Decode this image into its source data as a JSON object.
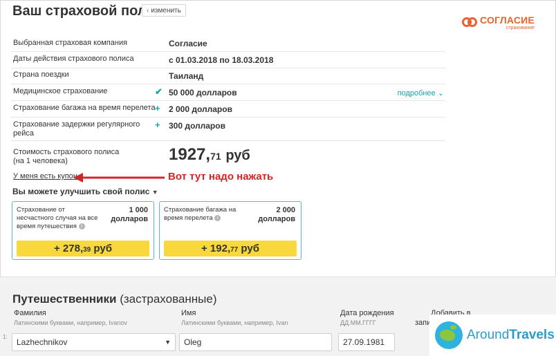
{
  "header": {
    "title": "Ваш страховой полис",
    "change_label": "изменить",
    "logo_name": "СОГЛАСИЕ",
    "logo_sub": "страхование"
  },
  "policy": {
    "rows": [
      {
        "label": "Выбранная страховая компания",
        "value": "Согласие",
        "icon": ""
      },
      {
        "label": "Даты действия страхового полиса",
        "value": "с 01.03.2018 по 18.03.2018",
        "icon": ""
      },
      {
        "label": "Страна поездки",
        "value": "Таиланд",
        "icon": ""
      },
      {
        "label": "Медицинское страхование",
        "value": "50 000 долларов",
        "icon": "check-icon",
        "more": "подробнее"
      },
      {
        "label": "Страхование багажа на время перелета",
        "value": "2 000 долларов",
        "icon": "plus-icon"
      },
      {
        "label": "Страхование задержки регулярного рейса",
        "value": "300 долларов",
        "icon": "plus-icon"
      }
    ],
    "price_label": "Стоимость страхового полиса (на 1 человека)",
    "price_int": "1927",
    "price_kop": "71",
    "price_cur": "руб",
    "coupon_label": "У меня есть купон",
    "annotation": "Вот тут надо нажать",
    "accent_color": "#1aa6a6",
    "annotation_color": "#d32525"
  },
  "upgrade": {
    "title": "Вы можете улучшить свой полис",
    "cards": [
      {
        "title": "Страхование от несчастного случая на все время путешествия",
        "amount_line1": "1 000",
        "amount_line2": "долларов",
        "price_sign": "+",
        "price_int": "278",
        "price_kop": "39",
        "price_cur": "руб"
      },
      {
        "title": "Страхование багажа на время перелета",
        "amount_line1": "2 000",
        "amount_line2": "долларов",
        "price_sign": "+",
        "price_int": "192",
        "price_kop": "77",
        "price_cur": "руб"
      }
    ],
    "button_color": "#f8d83d"
  },
  "travellers": {
    "title_bold": "Путешественники",
    "title_rest": "(застрахованные)",
    "index": "1:",
    "fields": {
      "surname_label": "Фамилия",
      "surname_hint": "Латинскими буквами, например, Ivanov",
      "surname_value": "Lazhechnikov",
      "name_label": "Имя",
      "name_hint": "Латинскими буквами, например, Ivan",
      "name_value": "Oleg",
      "dob_label": "Дата рождения",
      "dob_hint": "ДД.ММ.ГГГГ",
      "dob_value": "27.09.1981",
      "add_label": "Добавить в",
      "add_label2": "запи"
    }
  },
  "watermark": {
    "text_a": "Around",
    "text_b": "Travels"
  }
}
